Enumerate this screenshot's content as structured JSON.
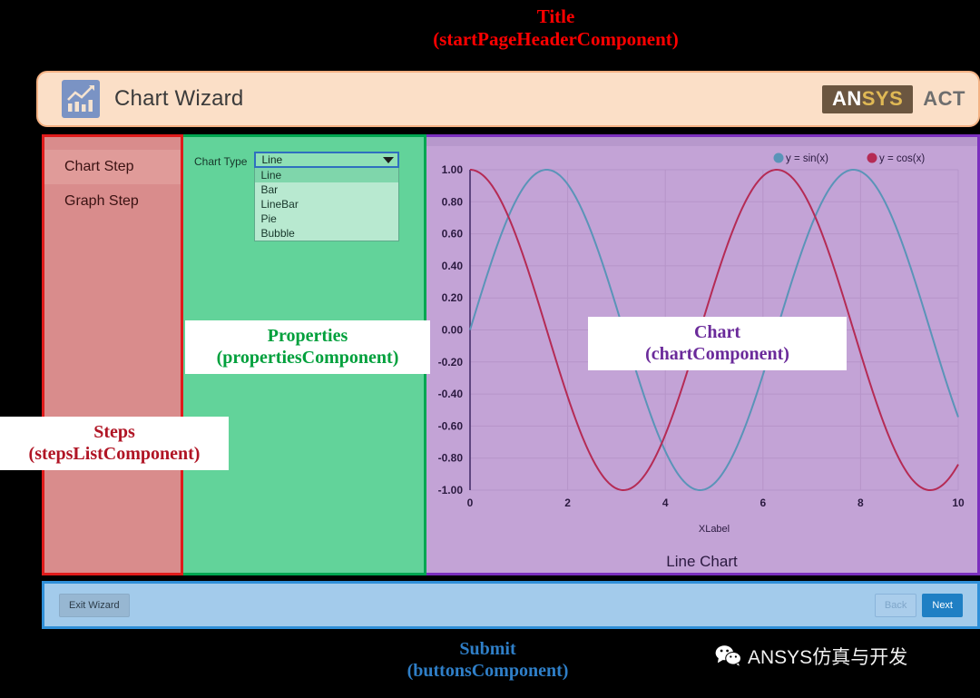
{
  "annotations": {
    "title": "Title\n(startPageHeaderComponent)",
    "steps": "Steps\n(stepsListComponent)",
    "properties": "Properties\n(propertiesComponent)",
    "chart": "Chart\n(chartComponent)",
    "submit": "Submit\n(buttonsComponent)",
    "colors": {
      "title": "#ff0000",
      "steps": "#b01424",
      "properties": "#00a03c",
      "chart": "#6a2a9a",
      "submit": "#2f7fc8"
    }
  },
  "watermark": {
    "text": "ANSYS仿真与开发",
    "icon": "wechat-icon"
  },
  "header": {
    "title": "Chart Wizard",
    "app_icon": "chart-bars-icon",
    "brand_an": "AN",
    "brand_sys": "SYS",
    "brand_suffix": "ACT",
    "brand_bg": "#6b5640"
  },
  "steps_panel": {
    "items": [
      {
        "label": "Chart Step",
        "active": true
      },
      {
        "label": "Graph Step",
        "active": false
      }
    ]
  },
  "properties_panel": {
    "chart_type_label": "Chart Type",
    "chart_type_value": "Line",
    "chart_type_options": [
      "Line",
      "Bar",
      "LineBar",
      "Pie",
      "Bubble"
    ],
    "chart_type_selected_index": 0,
    "dropdown_icon": "chevron-down-icon"
  },
  "footer": {
    "exit_label": "Exit Wizard",
    "back_label": "Back",
    "back_disabled": true,
    "next_label": "Next",
    "next_color": "#1f7fc4"
  },
  "chart_data": {
    "type": "line",
    "title": "Line Chart",
    "xlabel": "XLabel",
    "ylabel": "",
    "xlim": [
      0,
      10
    ],
    "ylim": [
      -1.0,
      1.0
    ],
    "xticks": [
      "0",
      "2",
      "4",
      "6",
      "8",
      "10"
    ],
    "yticks": [
      "1.00",
      "0.80",
      "0.60",
      "0.40",
      "0.20",
      "0.00",
      "-0.20",
      "-0.40",
      "-0.60",
      "-0.80",
      "-1.00"
    ],
    "grid": true,
    "legend_position": "top-right",
    "series": [
      {
        "name": "y = sin(x)",
        "color": "#5a94b8",
        "fn": "sin",
        "x": [
          0,
          0.5,
          1,
          1.5708,
          2,
          2.5,
          3,
          3.1416,
          3.5,
          4,
          4.5,
          4.7124,
          5,
          5.5,
          6,
          6.2832,
          6.5,
          7,
          7.5,
          7.854,
          8,
          8.5,
          9,
          9.4248,
          9.5,
          10
        ],
        "y": [
          0,
          0.479,
          0.841,
          1,
          0.909,
          0.599,
          0.141,
          0,
          -0.351,
          -0.757,
          -0.978,
          -1,
          -0.959,
          -0.706,
          -0.279,
          0,
          0.215,
          0.657,
          0.938,
          1,
          0.989,
          0.798,
          0.412,
          0,
          -0.075,
          -0.544
        ]
      },
      {
        "name": "y = cos(x)",
        "color": "#b52b55",
        "fn": "cos",
        "x": [
          0,
          0.5,
          1,
          1.5708,
          2,
          2.5,
          3,
          3.1416,
          3.5,
          4,
          4.5,
          4.7124,
          5,
          5.5,
          6,
          6.2832,
          6.5,
          7,
          7.5,
          7.854,
          8,
          8.5,
          9,
          9.4248,
          9.5,
          10
        ],
        "y": [
          1,
          0.878,
          0.54,
          0,
          -0.416,
          -0.801,
          -0.99,
          -1,
          -0.936,
          -0.654,
          -0.211,
          0,
          0.284,
          0.709,
          0.96,
          1,
          0.977,
          0.754,
          0.347,
          0,
          -0.146,
          -0.602,
          -0.911,
          -1,
          -0.997,
          -0.839
        ]
      }
    ]
  }
}
